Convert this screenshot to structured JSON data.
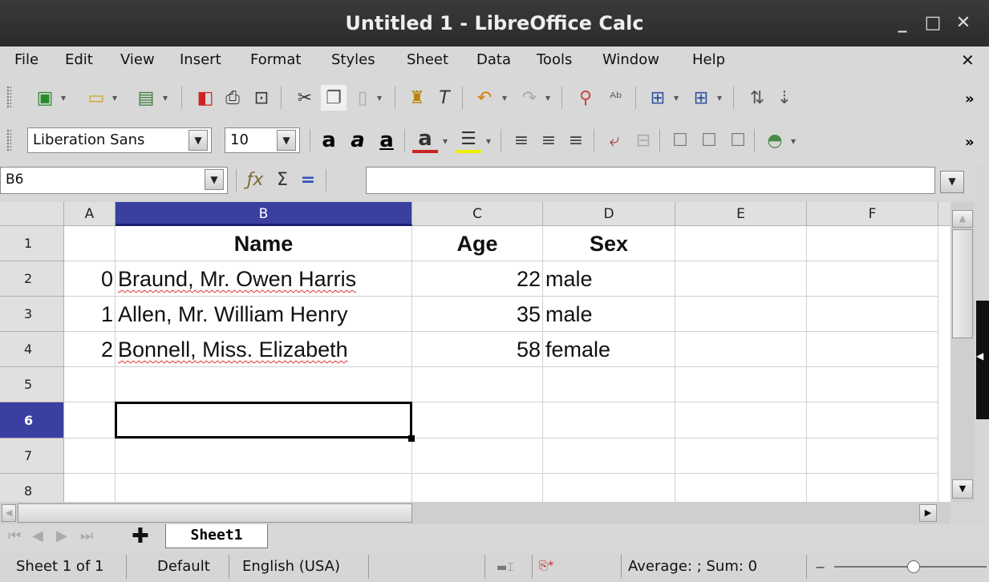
{
  "window": {
    "title": "Untitled 1 - LibreOffice Calc",
    "min": "_",
    "max": "□",
    "close": "✕"
  },
  "menu": [
    {
      "label": "File"
    },
    {
      "label": "Edit"
    },
    {
      "label": "View"
    },
    {
      "label": "Insert"
    },
    {
      "label": "Format"
    },
    {
      "label": "Styles"
    },
    {
      "label": "Sheet"
    },
    {
      "label": "Data"
    },
    {
      "label": "Tools"
    },
    {
      "label": "Window"
    },
    {
      "label": "Help"
    }
  ],
  "menu_close": "✕",
  "format_toolbar": {
    "font_name": "Liberation Sans",
    "font_size": "10"
  },
  "formula": {
    "name_box": "B6",
    "content": ""
  },
  "columns": [
    "A",
    "B",
    "C",
    "D",
    "E",
    "F"
  ],
  "rows": [
    "1",
    "2",
    "3",
    "4",
    "5",
    "6",
    "7",
    "8"
  ],
  "cells": {
    "B1": "Name",
    "C1": "Age",
    "D1": "Sex",
    "A2": "0",
    "B2": "Braund, Mr. Owen Harris",
    "C2": "22",
    "D2": "male",
    "A3": "1",
    "B3": "Allen, Mr. William Henry",
    "C3": "35",
    "D3": "male",
    "A4": "2",
    "B4": "Bonnell, Miss. Elizabeth",
    "C4": "58",
    "D4": "female"
  },
  "active_cell": "B6",
  "sheet_tab": "Sheet1",
  "status": {
    "sheet": "Sheet 1 of 1",
    "style": "Default",
    "language": "English (USA)",
    "sum": "Average: ; Sum: 0"
  },
  "colors": {
    "selected_header": "#3a3fa0",
    "title_bg": "#2f2f2f"
  }
}
